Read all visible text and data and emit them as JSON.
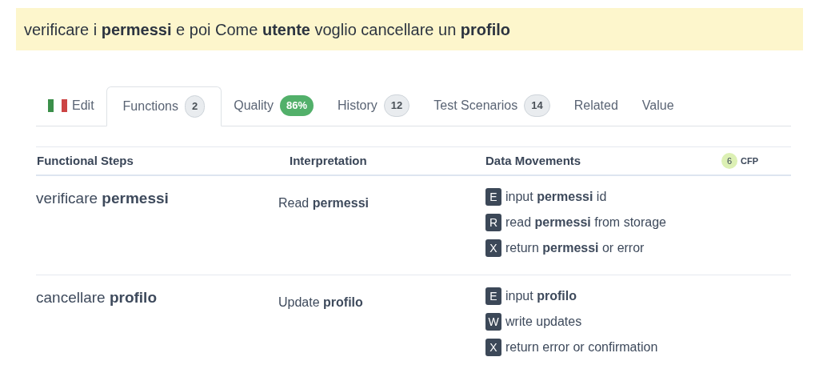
{
  "story": "verificare i **permessi** e poi Come **utente** voglio cancellare un **profilo**",
  "tabs": [
    {
      "label": "Edit",
      "kind": "flag",
      "selected": false
    },
    {
      "label": "Functions",
      "badge": {
        "text": "2",
        "kind": "count"
      },
      "selected": true
    },
    {
      "label": "Quality",
      "badge": {
        "text": "86%",
        "kind": "score"
      },
      "selected": false
    },
    {
      "label": "History",
      "badge": {
        "text": "12",
        "kind": "count"
      },
      "selected": false
    },
    {
      "label": "Test Scenarios",
      "badge": {
        "text": "14",
        "kind": "count"
      },
      "selected": false
    },
    {
      "label": "Related",
      "selected": false
    },
    {
      "label": "Value",
      "selected": false
    }
  ],
  "table": {
    "columns": [
      "Functional Steps",
      "Interpretation",
      "Data Movements"
    ],
    "cfp": {
      "count": "6",
      "label": "CFP"
    },
    "rows": [
      {
        "step": "verificare **permessi**",
        "interpretation": "Read **permessi**",
        "movements": [
          {
            "type": "E",
            "text": "input **permessi** id"
          },
          {
            "type": "R",
            "text": "read **permessi** from storage"
          },
          {
            "type": "X",
            "text": "return **permessi** or error"
          }
        ]
      },
      {
        "step": "cancellare **profilo**",
        "interpretation": "Update **profilo**",
        "movements": [
          {
            "type": "E",
            "text": "input **profilo**"
          },
          {
            "type": "W",
            "text": "write updates"
          },
          {
            "type": "X",
            "text": "return error or confirmation"
          }
        ]
      }
    ]
  }
}
